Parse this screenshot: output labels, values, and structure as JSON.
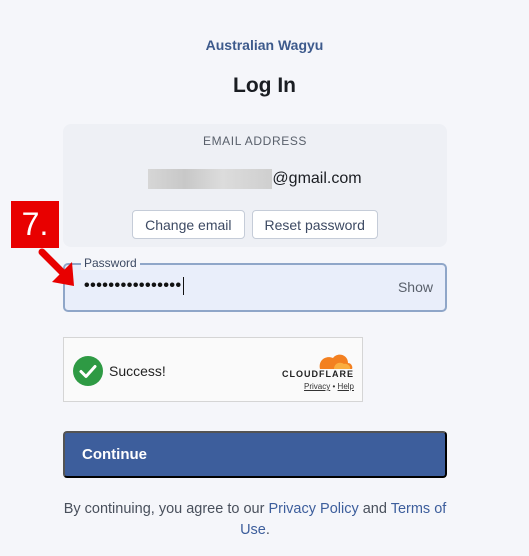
{
  "header": {
    "brand": "Australian Wagyu",
    "title": "Log In"
  },
  "email_card": {
    "label": "EMAIL ADDRESS",
    "email_domain": "@gmail.com",
    "change_email_label": "Change email",
    "reset_password_label": "Reset password"
  },
  "password": {
    "label": "Password",
    "value_masked": "••••••••••••••••",
    "show_label": "Show"
  },
  "captcha": {
    "status": "Success!",
    "provider": "CLOUDFLARE",
    "privacy_label": "Privacy",
    "separator": "•",
    "help_label": "Help"
  },
  "actions": {
    "continue_label": "Continue"
  },
  "legal": {
    "prefix": "By continuing, you agree to our ",
    "privacy_link": "Privacy Policy",
    "conjunction": " and ",
    "terms_link": "Terms of Use",
    "suffix": "."
  },
  "annotation": {
    "step_number": "7."
  },
  "colors": {
    "accent": "#3d5e9c",
    "background": "#f5f6fa",
    "badge": "#e80000",
    "success": "#2e9a44",
    "cloudflare_orange": "#f38020"
  }
}
